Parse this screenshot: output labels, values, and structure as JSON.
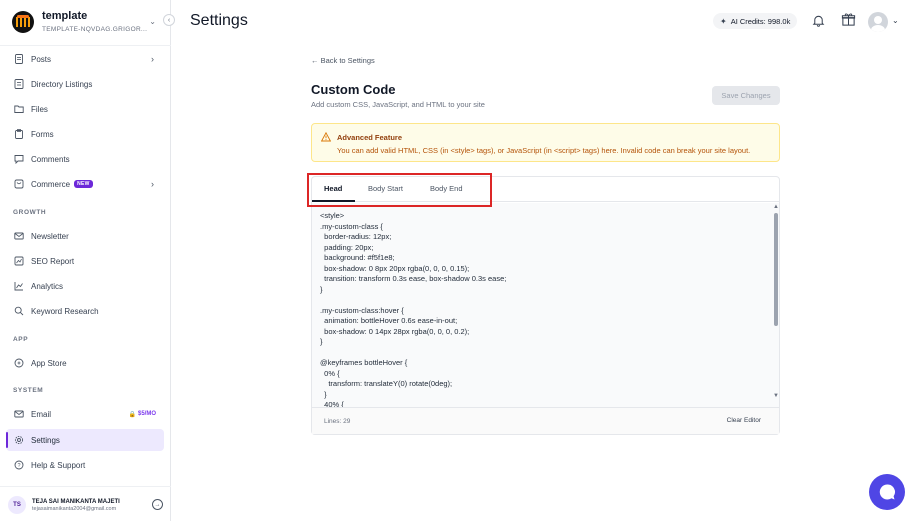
{
  "brand": {
    "name": "template",
    "subtitle": "TEMPLATE-NQVDAG.GRIGOR..."
  },
  "sidebar": {
    "items": [
      {
        "label": "Posts",
        "icon": "document-icon"
      },
      {
        "label": "Directory Listings",
        "icon": "list-icon"
      },
      {
        "label": "Files",
        "icon": "folder-icon"
      },
      {
        "label": "Forms",
        "icon": "clipboard-icon"
      },
      {
        "label": "Comments",
        "icon": "chat-icon"
      },
      {
        "label": "Commerce",
        "icon": "cart-icon",
        "badge": "NEW"
      }
    ],
    "sections": {
      "growth": "GROWTH",
      "app": "APP",
      "system": "SYSTEM"
    },
    "growth_items": [
      {
        "label": "Newsletter",
        "icon": "mail-icon"
      },
      {
        "label": "SEO Report",
        "icon": "report-icon"
      },
      {
        "label": "Analytics",
        "icon": "chart-icon"
      },
      {
        "label": "Keyword Research",
        "icon": "search-icon"
      }
    ],
    "app_items": [
      {
        "label": "App Store",
        "icon": "store-icon"
      }
    ],
    "system_items": [
      {
        "label": "Email",
        "icon": "mail-icon",
        "badge": "$5/MO"
      },
      {
        "label": "Settings",
        "icon": "gear-icon",
        "active": true
      },
      {
        "label": "Help & Support",
        "icon": "help-icon"
      }
    ]
  },
  "user": {
    "initials": "TS",
    "name": "TEJA SAI MANIKANTA MAJETI",
    "email": "tejasaimanikanta2004@gmail.com"
  },
  "header": {
    "title": "Settings",
    "ai_credits": "AI Credits: 998.0k"
  },
  "main": {
    "back_link": "← Back to Settings",
    "title": "Custom Code",
    "description": "Add custom CSS, JavaScript, and HTML to your site",
    "save_label": "Save Changes",
    "alert": {
      "title": "Advanced Feature",
      "text": "You can add valid HTML, CSS (in <style> tags), or JavaScript (in <script> tags) here. Invalid code can break your site layout."
    },
    "tabs": [
      {
        "label": "Head",
        "active": true
      },
      {
        "label": "Body Start",
        "active": false
      },
      {
        "label": "Body End",
        "active": false
      }
    ],
    "code": "<style>\n.my-custom-class {\n  border-radius: 12px;\n  padding: 20px;\n  background: #f5f1e8;\n  box-shadow: 0 8px 20px rgba(0, 0, 0, 0.15);\n  transition: transform 0.3s ease, box-shadow 0.3s ease;\n}\n\n.my-custom-class:hover {\n  animation: bottleHover 0.6s ease-in-out;\n  box-shadow: 0 14px 28px rgba(0, 0, 0, 0.2);\n}\n\n@keyframes bottleHover {\n  0% {\n    transform: translateY(0) rotate(0deg);\n  }\n  40% {",
    "lines_label": "Lines: 29",
    "clear_label": "Clear Editor"
  },
  "colors": {
    "accent": "#6d28d9",
    "alert_bg": "#fefce8",
    "alert_text": "#b45309",
    "highlight": "#dc2626",
    "chat_fab": "#4f46e5"
  }
}
